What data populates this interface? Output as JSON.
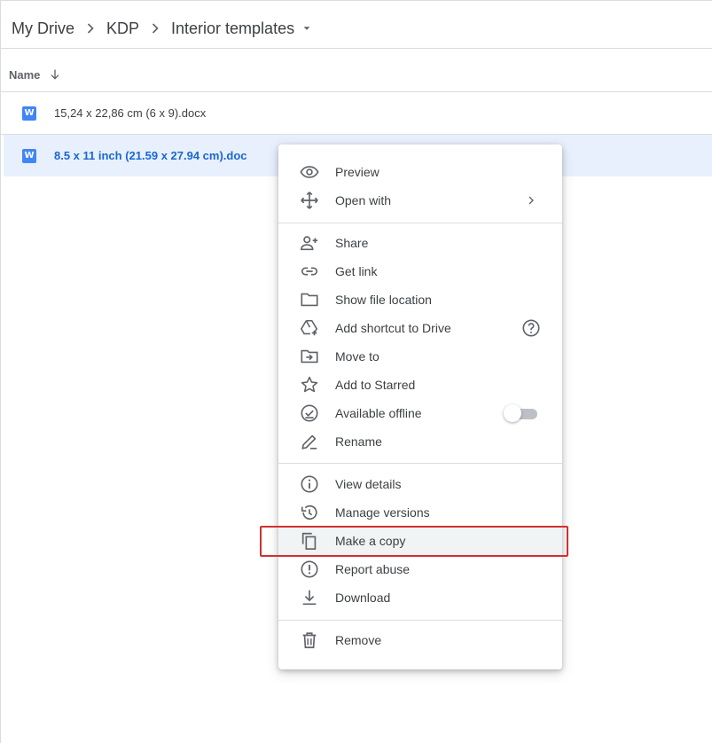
{
  "breadcrumb": {
    "items": [
      "My Drive",
      "KDP",
      "Interior templates"
    ]
  },
  "list_header": {
    "name_label": "Name",
    "sort_icon": "arrow-down-icon"
  },
  "files": [
    {
      "name": "15,24 x 22,86 cm (6 x 9).docx",
      "icon": "word-doc-icon",
      "icon_letter": "W",
      "selected": false
    },
    {
      "name": "8.5 x 11 inch (21.59 x 27.94 cm).doc",
      "icon": "word-doc-icon",
      "icon_letter": "W",
      "selected": true
    }
  ],
  "context_menu": {
    "items": [
      {
        "label": "Preview",
        "icon": "eye-icon"
      },
      {
        "label": "Open with",
        "icon": "move-arrows-icon"
      },
      {
        "label": "Share",
        "icon": "person-add-icon"
      },
      {
        "label": "Get link",
        "icon": "link-icon"
      },
      {
        "label": "Show file location",
        "icon": "folder-icon"
      },
      {
        "label": "Add shortcut to Drive",
        "icon": "drive-shortcut-icon"
      },
      {
        "label": "Move to",
        "icon": "folder-move-icon"
      },
      {
        "label": "Add to Starred",
        "icon": "star-icon"
      },
      {
        "label": "Available offline",
        "icon": "offline-check-icon",
        "toggle_on": false
      },
      {
        "label": "Rename",
        "icon": "pencil-icon"
      },
      {
        "label": "View details",
        "icon": "info-icon"
      },
      {
        "label": "Manage versions",
        "icon": "history-icon"
      },
      {
        "label": "Make a copy",
        "icon": "copy-icon",
        "highlighted": true
      },
      {
        "label": "Report abuse",
        "icon": "report-icon"
      },
      {
        "label": "Download",
        "icon": "download-icon"
      },
      {
        "label": "Remove",
        "icon": "trash-icon"
      }
    ]
  },
  "colors": {
    "selected_row_bg": "#e8f0fe",
    "selected_text": "#1967d2",
    "word_icon": "#4285f4",
    "highlight_border": "#d32f2f",
    "icon_gray": "#5f6368"
  }
}
